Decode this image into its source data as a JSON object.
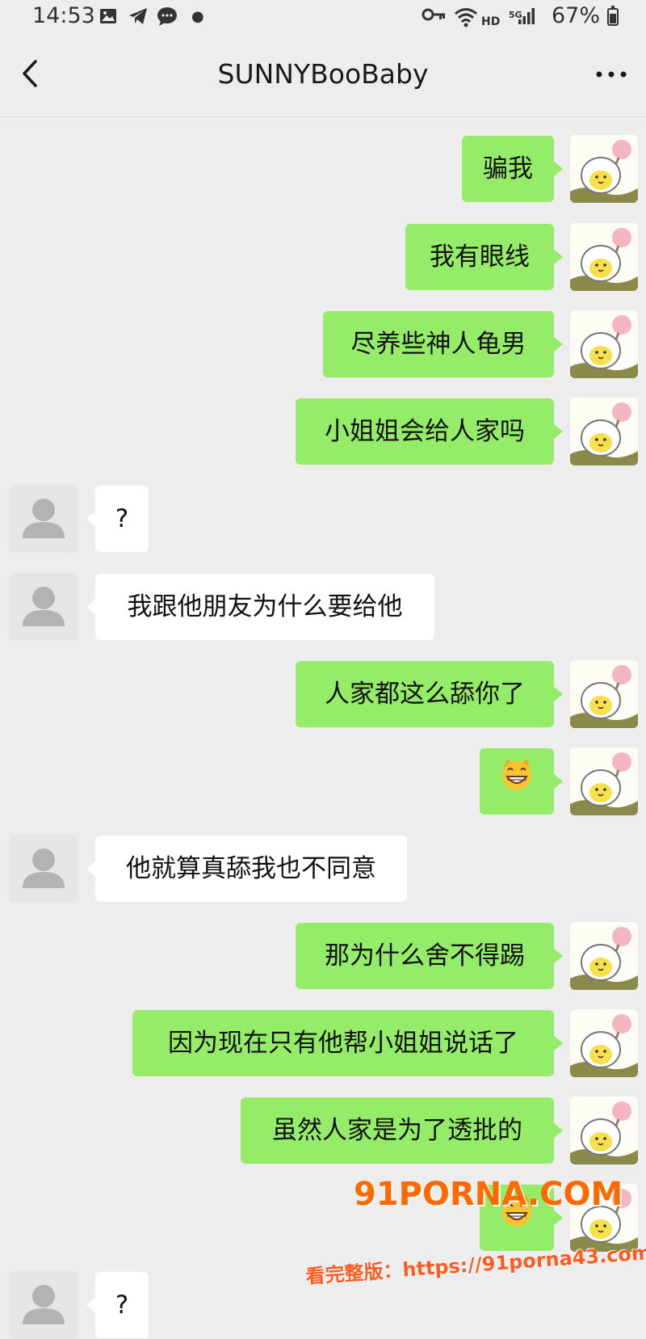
{
  "status_bar": {
    "time": "14:53",
    "network": "HD",
    "signal": "5G",
    "battery": "67%"
  },
  "header": {
    "title": "SUNNYBooBaby"
  },
  "messages": [
    {
      "side": "right",
      "text": "骗我"
    },
    {
      "side": "right",
      "text": "我有眼线"
    },
    {
      "side": "right",
      "text": "尽养些神人龟男"
    },
    {
      "side": "right",
      "text": "小姐姐会给人家吗"
    },
    {
      "side": "left",
      "text": "?"
    },
    {
      "side": "left",
      "text": "我跟他朋友为什么要给他"
    },
    {
      "side": "right",
      "text": "人家都这么舔你了"
    },
    {
      "side": "right",
      "text": "",
      "emoji": "grinning-cat-emoji"
    },
    {
      "side": "left",
      "text": "他就算真舔我也不同意"
    },
    {
      "side": "right",
      "text": "那为什么舍不得踢"
    },
    {
      "side": "right",
      "text": "因为现在只有他帮小姐姐说话了"
    },
    {
      "side": "right",
      "text": "虽然人家是为了透批的"
    },
    {
      "side": "right",
      "text": "",
      "emoji": "grinning-cat-emoji"
    },
    {
      "side": "left",
      "text": "?"
    }
  ],
  "watermark": {
    "brand": "91PORNA.COM",
    "url": "看完整版：https://91porna43.com"
  },
  "colors": {
    "sent_bubble": "#95ec69",
    "received_bubble": "#ffffff",
    "background": "#ededed",
    "watermark": "#ff6a00"
  },
  "icons": [
    "back-arrow-icon",
    "more-options-icon",
    "user-avatar-icon",
    "sticker-avatar-icon"
  ]
}
